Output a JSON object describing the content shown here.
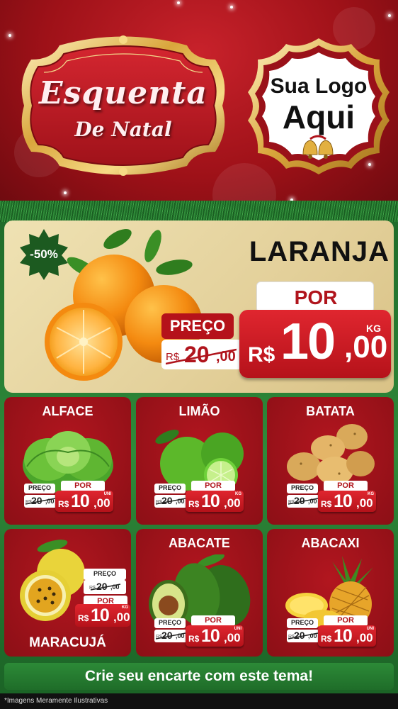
{
  "header": {
    "title_line1": "Esquenta",
    "title_line2": "De Natal",
    "logo_line1": "Sua Logo",
    "logo_line2": "Aqui"
  },
  "featured": {
    "name": "LARANJA",
    "discount": "-50%",
    "preco_label": "PREÇO",
    "old_currency": "R$",
    "old_int": "20",
    "old_cents": ",00",
    "por_label": "POR",
    "currency": "R$",
    "price_int": "10",
    "price_cents": ",00",
    "unit": "KG"
  },
  "products": [
    {
      "name": "ALFACE",
      "preco_label": "PREÇO",
      "old_currency": "R$",
      "old_int": "20",
      "old_cents": ",00",
      "por_label": "POR",
      "currency": "R$",
      "price_int": "10",
      "price_cents": ",00",
      "unit": "UNI"
    },
    {
      "name": "LIMÃO",
      "preco_label": "PREÇO",
      "old_currency": "R$",
      "old_int": "20",
      "old_cents": ",00",
      "por_label": "POR",
      "currency": "R$",
      "price_int": "10",
      "price_cents": ",00",
      "unit": "KG"
    },
    {
      "name": "BATATA",
      "preco_label": "PREÇO",
      "old_currency": "R$",
      "old_int": "20",
      "old_cents": ",00",
      "por_label": "POR",
      "currency": "R$",
      "price_int": "10",
      "price_cents": ",00",
      "unit": "KG"
    },
    {
      "name": "MARACUJÁ",
      "preco_label": "PREÇO",
      "old_currency": "R$",
      "old_int": "20",
      "old_cents": ",00",
      "por_label": "POR",
      "currency": "R$",
      "price_int": "10",
      "price_cents": ",00",
      "unit": "KG"
    },
    {
      "name": "ABACATE",
      "preco_label": "PREÇO",
      "old_currency": "R$",
      "old_int": "20",
      "old_cents": ",00",
      "por_label": "POR",
      "currency": "R$",
      "price_int": "10",
      "price_cents": ",00",
      "unit": "UNI"
    },
    {
      "name": "ABACAXI",
      "preco_label": "PREÇO",
      "old_currency": "R$",
      "old_int": "20",
      "old_cents": ",00",
      "por_label": "POR",
      "currency": "R$",
      "price_int": "10",
      "price_cents": ",00",
      "unit": "UNI"
    }
  ],
  "footer": {
    "cta": "Crie seu encarte com este tema!",
    "disclaimer": "*Imagens Meramente Ilustrativas"
  },
  "colors": {
    "header_red": "#b3151d",
    "price_red": "#d41f28",
    "gold": "#d9b04a",
    "green": "#2a8334",
    "featured_bg": "#e8d7a6"
  },
  "icons": [
    "orange-fruit-icon",
    "lettuce-icon",
    "lime-icon",
    "potato-icon",
    "passion-fruit-icon",
    "avocado-icon",
    "pineapple-icon",
    "bells-icon",
    "discount-star-icon"
  ]
}
